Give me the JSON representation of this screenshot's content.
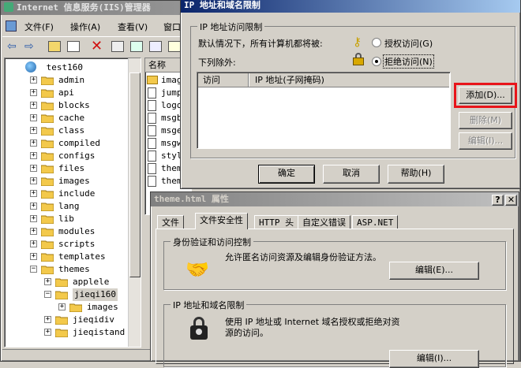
{
  "iis_window": {
    "title": "Internet 信息服务(IIS)管理器",
    "menu": [
      "文件(F)",
      "操作(A)",
      "查看(V)",
      "窗口"
    ],
    "tree_root": "test160",
    "tree_items": [
      "admin",
      "api",
      "blocks",
      "cache",
      "class",
      "compiled",
      "configs",
      "files",
      "images",
      "include",
      "lang",
      "lib",
      "modules",
      "scripts",
      "templates",
      "themes"
    ],
    "themes_children": [
      "applele",
      "jieqi160",
      "jieqidiv",
      "jieqistand"
    ],
    "jieqi160_children": [
      "images"
    ],
    "list_header": "名称",
    "list_items": [
      "imag",
      "jump",
      "logo",
      "msgb",
      "msge",
      "msgw",
      "styl",
      "them",
      "them"
    ]
  },
  "ip_dialog": {
    "title": "IP 地址和域名限制",
    "group_label": "IP 地址访问限制",
    "default_text": "默认情况下，所有计算机都将被:",
    "except_text": "下列除外:",
    "radio_grant": "授权访问(G)",
    "radio_deny": "拒绝访问(N)",
    "col_access": "访问",
    "col_ip": "IP 地址(子网掩码)",
    "btn_add": "添加(D)...",
    "btn_remove": "删除(M)",
    "btn_edit": "编辑(I)...",
    "btn_ok": "确定",
    "btn_cancel": "取消",
    "btn_help": "帮助(H)"
  },
  "props_dialog": {
    "title": "theme.html 属性",
    "tabs": [
      "文件",
      "文件安全性",
      "HTTP 头",
      "自定义错误",
      "ASP.NET"
    ],
    "auth_group": "身份验证和访问控制",
    "auth_text": "允许匿名访问资源及编辑身份验证方法。",
    "auth_edit": "编辑(E)...",
    "ip_group": "IP 地址和域名限制",
    "ip_text": "使用 IP 地址或 Internet 域名授权或拒绝对资源的访问。",
    "ip_edit": "编辑(I)..."
  },
  "colors": {
    "highlight": "#e8141a",
    "title_active": "#0a246a",
    "title_inactive": "#808080"
  }
}
